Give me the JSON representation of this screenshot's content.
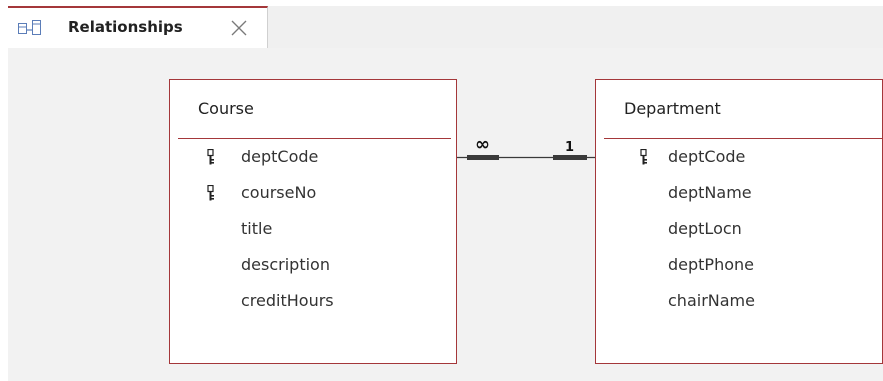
{
  "tab": {
    "icon": "relationships-icon",
    "label": "Relationships",
    "close_icon": "close-icon"
  },
  "tables": {
    "course": {
      "title": "Course",
      "fields": [
        {
          "name": "deptCode",
          "is_key": true
        },
        {
          "name": "courseNo",
          "is_key": true
        },
        {
          "name": "title",
          "is_key": false
        },
        {
          "name": "description",
          "is_key": false
        },
        {
          "name": "creditHours",
          "is_key": false
        }
      ]
    },
    "department": {
      "title": "Department",
      "fields": [
        {
          "name": "deptCode",
          "is_key": true
        },
        {
          "name": "deptName",
          "is_key": false
        },
        {
          "name": "deptLocn",
          "is_key": false
        },
        {
          "name": "deptPhone",
          "is_key": false
        },
        {
          "name": "chairName",
          "is_key": false
        }
      ]
    }
  },
  "relationship": {
    "many_label": "∞",
    "one_label": "1"
  },
  "colors": {
    "accent": "#a4373a",
    "canvas": "#f2f2f2",
    "tabstrip": "#f0f0f0"
  }
}
